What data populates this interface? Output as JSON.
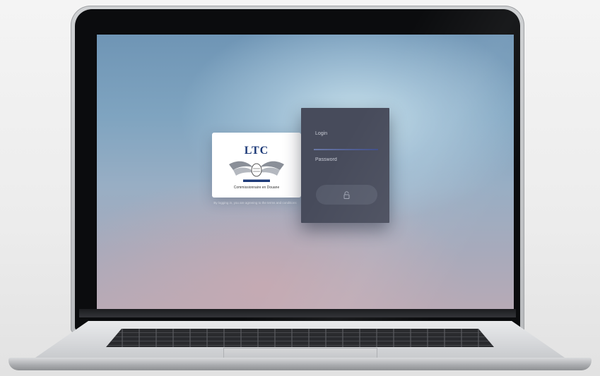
{
  "brand": {
    "logo_text": "LTC",
    "caption": "Commissionnaire en Douane"
  },
  "legal_notice": "By logging in, you are agreeing to the terms and conditions",
  "login_form": {
    "login_label": "Login",
    "login_value": "",
    "password_placeholder": "Password",
    "submit_icon": "lock-icon"
  },
  "colors": {
    "panel_bg": "#474b5b",
    "accent": "#3e4c86",
    "logo_blue": "#1d3a78"
  }
}
